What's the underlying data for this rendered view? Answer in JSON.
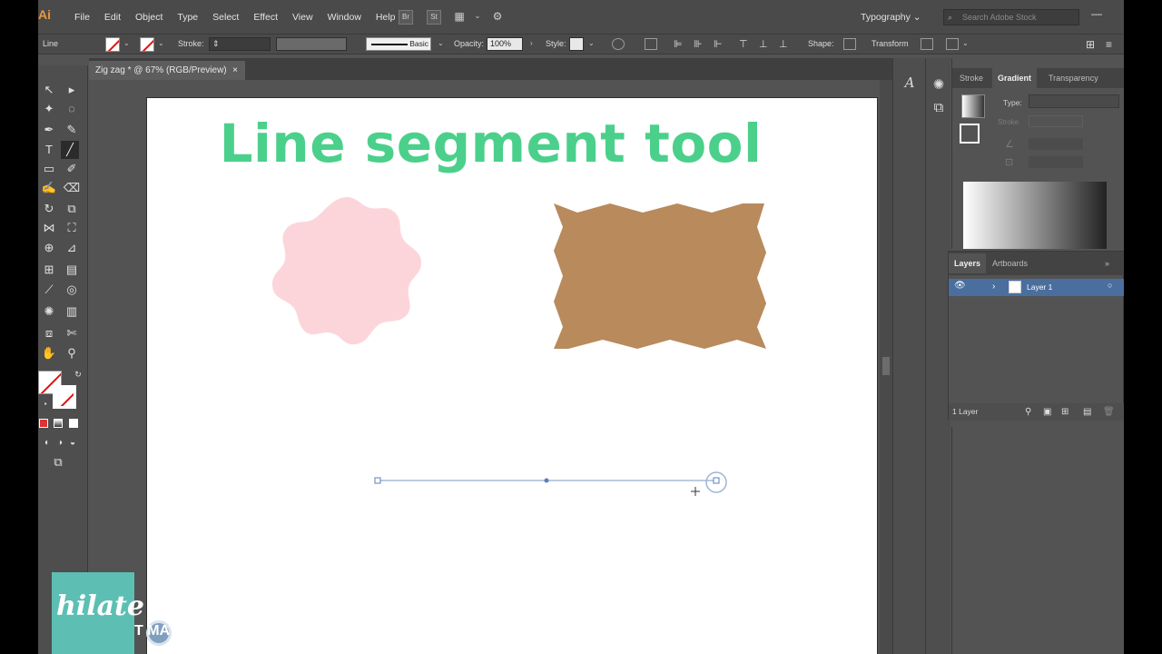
{
  "app": {
    "logo": "Ai",
    "menu": [
      "File",
      "Edit",
      "Object",
      "Type",
      "Select",
      "Effect",
      "View",
      "Window",
      "Help"
    ],
    "workspace": "Typography",
    "search_placeholder": "Search Adobe Stock",
    "st_label": "St"
  },
  "control_bar": {
    "selection_type": "Line",
    "stroke_label": "Stroke:",
    "brush_label": "Basic",
    "opacity_label": "Opacity:",
    "opacity_value": "100%",
    "style_label": "Style:",
    "shape_label": "Shape:",
    "transform_label": "Transform"
  },
  "document": {
    "tab_title": "Zig zag * @ 67% (RGB/Preview)",
    "tab_close": "×",
    "heading": "Line segment tool",
    "colors": {
      "heading": "#4bd08b",
      "pink_shape": "#fcd5da",
      "brown_shape": "#b88a5c",
      "path": "#7b95c5"
    }
  },
  "gradient_panel": {
    "tabs": [
      "Stroke",
      "Gradient",
      "Transparency"
    ],
    "type_label": "Type:",
    "stroke_label": "Stroke"
  },
  "layers_panel": {
    "tabs": [
      "Layers",
      "Artboards"
    ],
    "layer_name": "Layer 1",
    "footer": "1 Layer"
  },
  "watermark": {
    "brand": "hilate",
    "automatic": "T    MATIC"
  }
}
